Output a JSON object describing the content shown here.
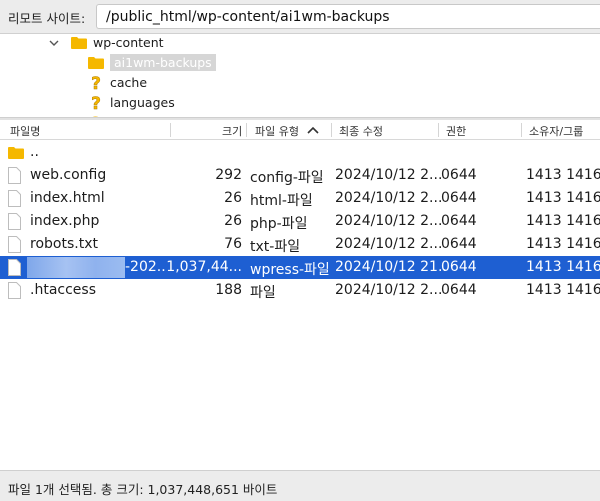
{
  "remote_site": {
    "label": "리모트 사이트:",
    "path": "/public_html/wp-content/ai1wm-backups"
  },
  "tree": {
    "items": [
      {
        "label": "wp-content",
        "icon": "folder-icon",
        "expanded": true
      },
      {
        "label": "ai1wm-backups",
        "icon": "folder-icon",
        "selected": true
      },
      {
        "label": "cache",
        "icon": "unknown-folder-icon"
      },
      {
        "label": "languages",
        "icon": "unknown-folder-icon"
      }
    ]
  },
  "columns": {
    "name": "파일명",
    "size": "크기",
    "type": "파일 유형",
    "modified": "최종 수정",
    "permissions": "권한",
    "owner": "소유자/그룹",
    "sort_column": "type",
    "sort_direction": "ascending"
  },
  "files": [
    {
      "name": "..",
      "size": "",
      "type": "",
      "modified": "",
      "permissions": "",
      "owner": "",
      "icon": "folder-icon"
    },
    {
      "name": "web.config",
      "size": "292",
      "type": "config-파일",
      "modified": "2024/10/12 2...",
      "permissions": "0644",
      "owner": "1413 1416",
      "icon": "file-icon"
    },
    {
      "name": "index.html",
      "size": "26",
      "type": "html-파일",
      "modified": "2024/10/12 2...",
      "permissions": "0644",
      "owner": "1413 1416",
      "icon": "file-icon"
    },
    {
      "name": "index.php",
      "size": "26",
      "type": "php-파일",
      "modified": "2024/10/12 2...",
      "permissions": "0644",
      "owner": "1413 1416",
      "icon": "file-icon"
    },
    {
      "name": "robots.txt",
      "size": "76",
      "type": "txt-파일",
      "modified": "2024/10/12 2...",
      "permissions": "0644",
      "owner": "1413 1416",
      "icon": "file-icon"
    },
    {
      "name": "-202..",
      "size": "1,037,44...",
      "type": "wpress-파일",
      "modified": "2024/10/12 21..",
      "permissions": "0644",
      "owner": "1413 1416",
      "icon": "file-icon",
      "selected": true,
      "name_redacted": true
    },
    {
      "name": ".htaccess",
      "size": "188",
      "type": "파일",
      "modified": "2024/10/12 2...",
      "permissions": "0644",
      "owner": "1413 1416",
      "icon": "file-icon"
    }
  ],
  "status": {
    "text": "파일 1개 선택됨. 총 크기: 1,037,448,651 바이트"
  },
  "colors": {
    "selection": "#1e5fd2",
    "folder": "#f5b800",
    "tree_selection": "#d6d6d6"
  }
}
